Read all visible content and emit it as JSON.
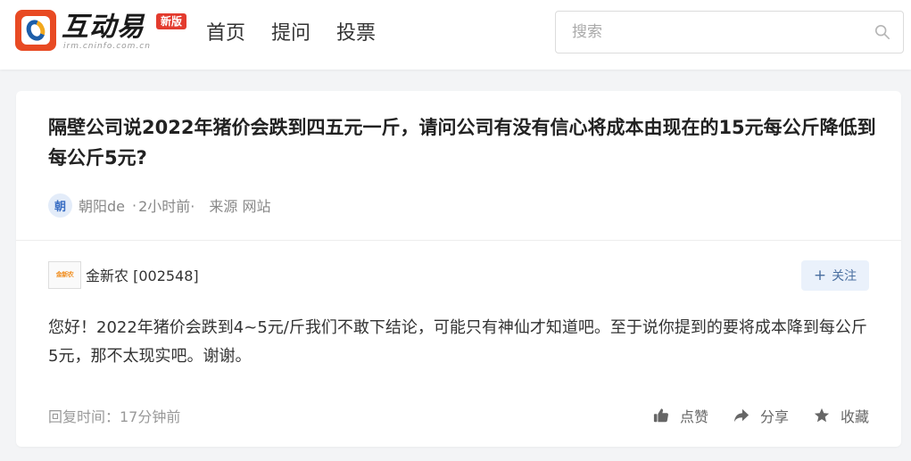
{
  "header": {
    "logo_text": "互动易",
    "logo_sub": "irm.cninfo.com.cn",
    "logo_badge": "新版",
    "nav": [
      {
        "label": "首页"
      },
      {
        "label": "提问"
      },
      {
        "label": "投票"
      }
    ],
    "search_placeholder": "搜索"
  },
  "question": {
    "title": "隔壁公司说2022年猪价会跌到四五元一斤，请问公司有没有信心将成本由现在的15元每公斤降低到每公斤5元?",
    "avatar_char": "朝",
    "author": "朝阳de",
    "separator": "·",
    "time": "2小时前·",
    "source": "来源 网站"
  },
  "answer": {
    "company_logo_text": "金新农",
    "company": "金新农 [002548]",
    "follow_label": "关注",
    "body": "您好！2022年猪价会跌到4~5元/斤我们不敢下结论，可能只有神仙才知道吧。至于说你提到的要将成本降到每公斤5元，那不太现实吧。谢谢。",
    "reply_time": "回复时间：17分钟前",
    "actions": {
      "like": "点赞",
      "share": "分享",
      "collect": "收藏"
    }
  }
}
